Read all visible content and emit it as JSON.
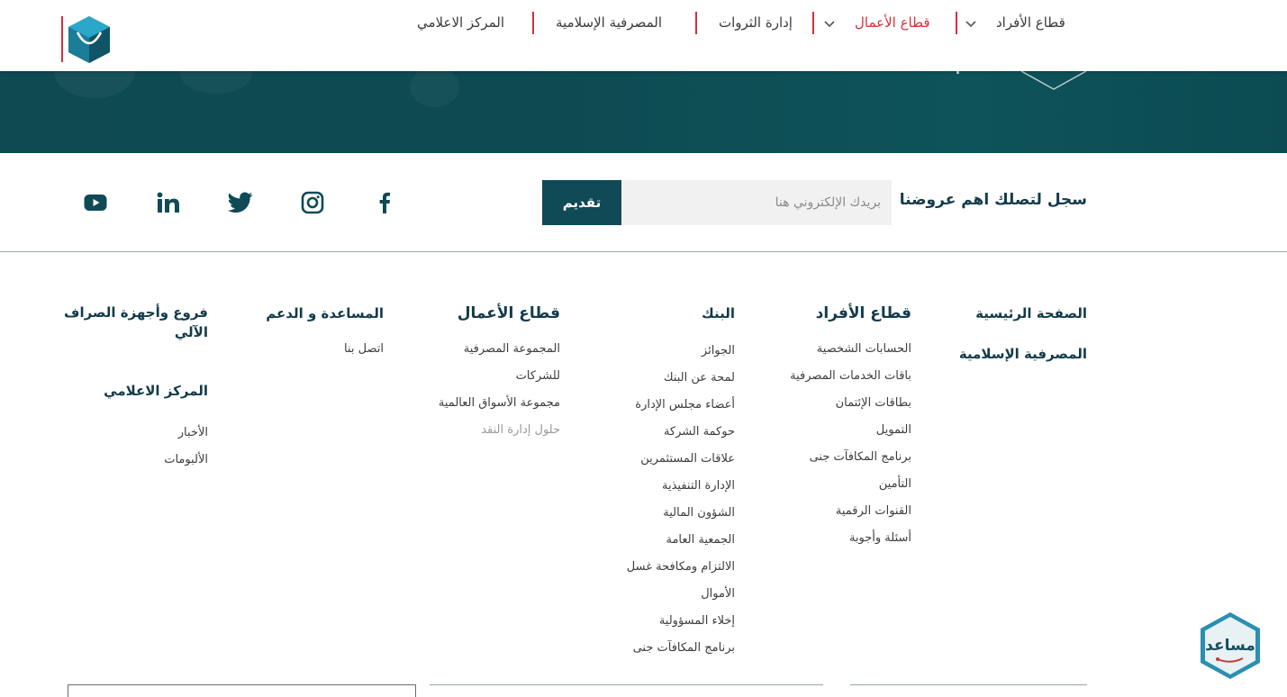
{
  "header": {
    "nav": [
      {
        "label": "قطاع الأفراد",
        "has_dropdown": true
      },
      {
        "label": "قطاع الأعمال",
        "has_dropdown": true,
        "active": true
      },
      {
        "label": "إدارة الثروات",
        "has_dropdown": false
      },
      {
        "label": "المصرفية الإسلامية",
        "has_dropdown": false
      },
      {
        "label": "المركز الاعلامي",
        "has_dropdown": false
      }
    ]
  },
  "newsletter": {
    "title": "سجل لتصلك اهم عروضنا",
    "placeholder": "بريدك الإلكتروني هنا",
    "submit_label": "تقديم",
    "social_icons": [
      "facebook-icon",
      "instagram-icon",
      "twitter-icon",
      "linkedin-icon",
      "youtube-icon"
    ]
  },
  "footer": {
    "main_links": [
      "الصفحة الرئيسية",
      "المصرفية الإسلامية"
    ],
    "individuals": {
      "title": "قطاع الأفراد",
      "items": [
        "الحسابات الشخصية",
        "باقات الخدمات المصرفية",
        "بطاقات الإئتمان",
        "التمويل",
        "برنامج المكافآت جنى",
        "التأمين",
        "القنوات الرقمية",
        "أسئلة وأجوبة"
      ]
    },
    "bank": {
      "title": "البنك",
      "items": [
        "الجوائز",
        "لمحة عن البنك",
        "أعضاء مجلس الإدارة",
        "حوكمة الشركة",
        "علاقات المستثمرين",
        "الإدارة التنفيذية",
        "الشؤون المالية",
        "الجمعية العامة",
        "الالتزام ومكافحة غسل",
        "الأموال",
        "إخلاء المسؤولية",
        "برنامج المكافآت جنى"
      ]
    },
    "business": {
      "title": "قطاع الأعمال",
      "items": [
        "المجموعة المصرفية",
        "للشركات",
        "مجموعة الأسواق العالمية",
        "حلول إدارة النقد"
      ]
    },
    "support": {
      "title": "المساعدة و الدعم",
      "items": [
        "اتصل بنا"
      ]
    },
    "branches": {
      "title": "فروع وأجهزة الصراف الآلي",
      "media_title": "المركز الاعلامي",
      "media_items": [
        "الأخبار",
        "الألبومات"
      ]
    }
  },
  "assistant": {
    "label": "مساعد"
  },
  "colors": {
    "brand_dark": "#0f4a56",
    "accent_red": "#d6303a",
    "heading": "#123b4a"
  }
}
